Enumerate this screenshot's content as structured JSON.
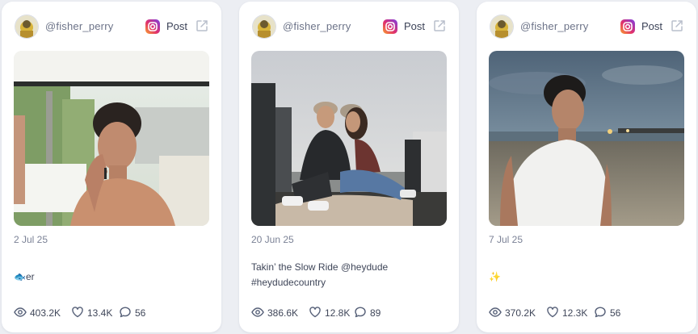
{
  "colors": {
    "background": "#eceef3",
    "card": "#ffffff",
    "handle_text": "#6c7388",
    "body_text": "#3f4659",
    "icon_gray": "#566078"
  },
  "cards": [
    {
      "handle": "@fisher_perry",
      "platform_icon": "instagram-icon",
      "post_label": "Post",
      "external_icon": "external-link-icon",
      "date": "2 Jul 25",
      "caption_icon": "fish-emoji",
      "caption_emoji": "🐟",
      "caption": "er",
      "stats": {
        "views": "403.2K",
        "likes": "13.4K",
        "comments": "56"
      }
    },
    {
      "handle": "@fisher_perry",
      "platform_icon": "instagram-icon",
      "post_label": "Post",
      "external_icon": "external-link-icon",
      "date": "20 Jun 25",
      "caption": "Takin’ the Slow Ride @heydude #heydudecountry",
      "stats": {
        "views": "386.6K",
        "likes": "12.8K",
        "comments": "89"
      }
    },
    {
      "handle": "@fisher_perry",
      "platform_icon": "instagram-icon",
      "post_label": "Post",
      "external_icon": "external-link-icon",
      "date": "7 Jul 25",
      "caption_icon": "sparkles-emoji",
      "caption_emoji": "✨",
      "caption": "",
      "stats": {
        "views": "370.2K",
        "likes": "12.3K",
        "comments": "56"
      }
    }
  ],
  "stat_icons": {
    "views": "eye-icon",
    "likes": "heart-icon",
    "comments": "comment-icon"
  }
}
